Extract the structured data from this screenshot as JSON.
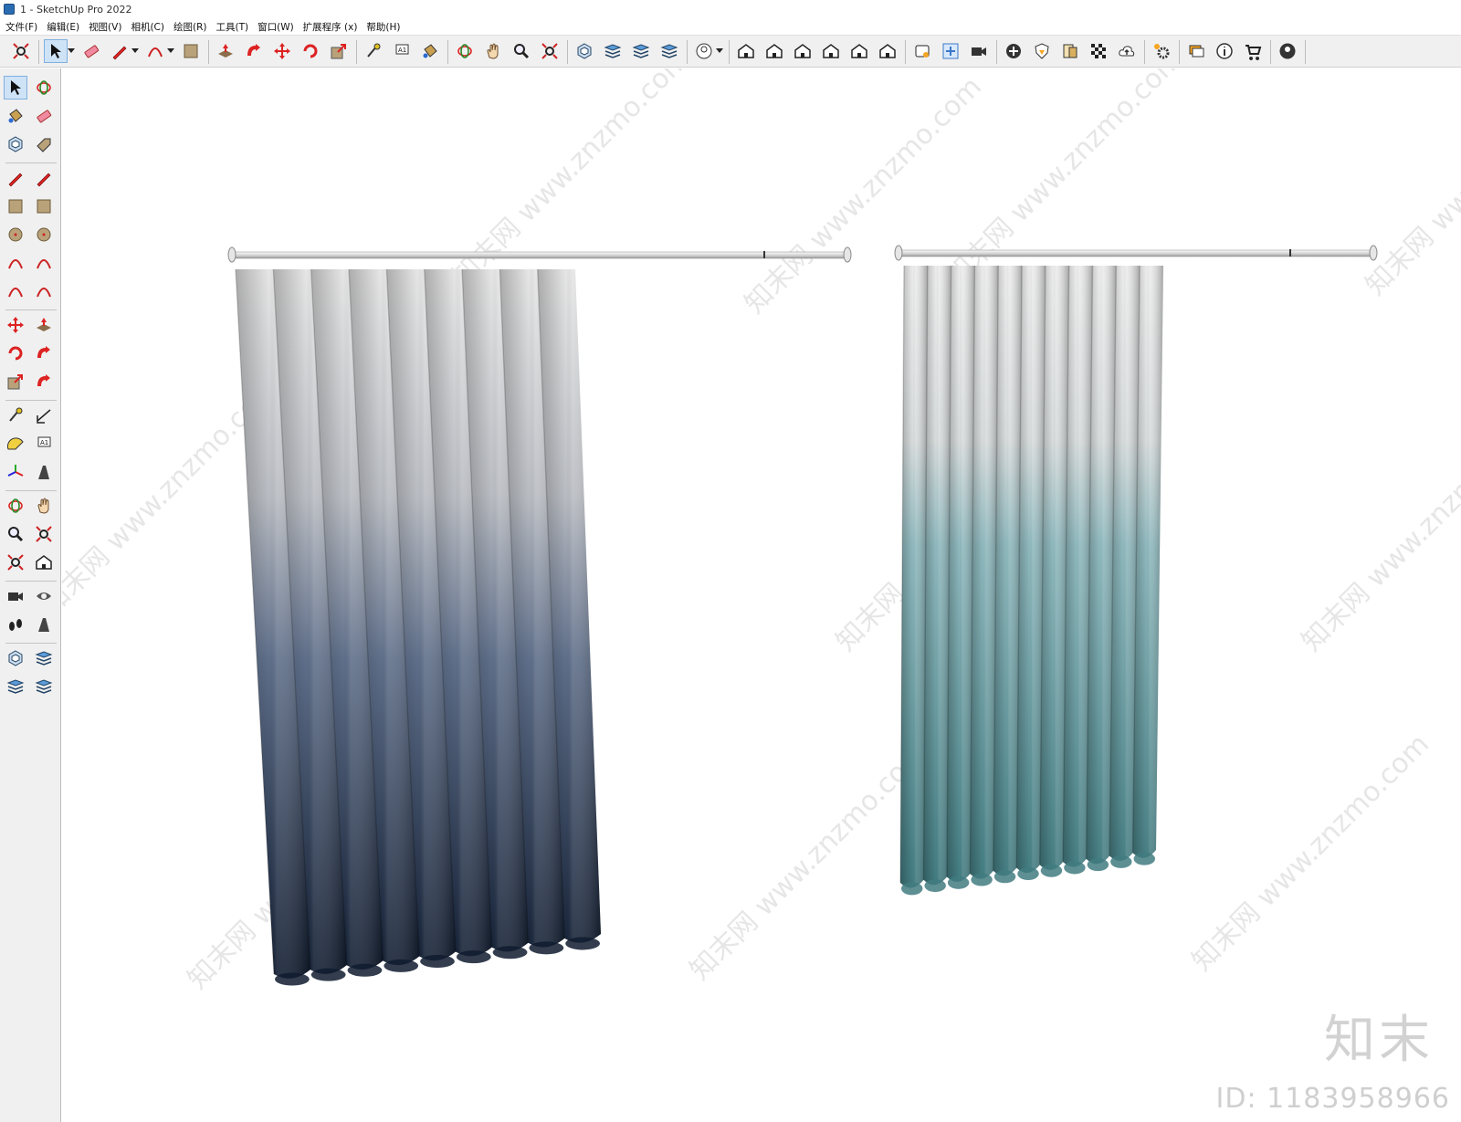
{
  "window": {
    "title": "1 - SketchUp Pro 2022"
  },
  "menu": {
    "items": [
      "文件(F)",
      "编辑(E)",
      "视图(V)",
      "相机(C)",
      "绘图(R)",
      "工具(T)",
      "窗口(W)",
      "扩展程序 (x)",
      "帮助(H)"
    ]
  },
  "toolbar": {
    "groups": [
      [
        "zoom-extents-icon"
      ],
      [
        "select-icon",
        "eraser-icon",
        "pencil-line-icon",
        "arc-icon",
        "rectangle-icon"
      ],
      [
        "push-pull-icon",
        "follow-me-icon",
        "move-icon",
        "rotate-icon",
        "scale-icon"
      ],
      [
        "tape-measure-icon",
        "text-label-icon",
        "paint-bucket-icon"
      ],
      [
        "orbit-icon",
        "pan-icon",
        "zoom-icon",
        "zoom-extents-icon"
      ],
      [
        "sandbox-icon",
        "layers-icon",
        "layer-stack-icon",
        "tags-icon"
      ],
      [
        "user-profile-icon"
      ],
      [
        "iso-view-icon",
        "top-view-icon",
        "front-view-icon",
        "right-view-icon",
        "back-view-icon",
        "left-view-icon"
      ],
      [
        "warehouse-icon",
        "extension-manager-icon",
        "camera-record-icon"
      ],
      [
        "add-location-icon",
        "shield-icon",
        "materials-icon",
        "checker-icon",
        "cloud-upload-icon"
      ],
      [
        "settings-icon"
      ],
      [
        "chat-icon",
        "info-icon",
        "cart-icon"
      ],
      [
        "account-icon"
      ]
    ]
  },
  "left_toolbar": {
    "items": [
      "select-icon",
      "orbit-icon",
      "paint-bucket-icon",
      "eraser-icon",
      "component-icon",
      "tag-icon",
      "pencil-line-icon",
      "freehand-icon",
      "rectangle-icon",
      "rotated-rectangle-icon",
      "circle-icon",
      "polygon-icon",
      "arc-icon",
      "two-point-arc-icon",
      "three-point-arc-icon",
      "pie-icon",
      "move-icon",
      "push-pull-icon",
      "rotate-icon",
      "follow-me-icon",
      "scale-icon",
      "offset-icon",
      "tape-measure-icon",
      "dimension-icon",
      "protractor-icon",
      "text-icon",
      "axes-icon",
      "section-plane-icon",
      "orbit-icon",
      "pan-icon",
      "zoom-icon",
      "zoom-window-icon",
      "zoom-extents-icon",
      "previous-view-icon",
      "position-camera-icon",
      "look-around-icon",
      "walk-icon",
      "section-cut-icon",
      "sandbox-icon",
      "layers-icon",
      "layer-stack-icon",
      "tags-icon"
    ]
  },
  "scene": {
    "watermark": "知末网 www.znzmo.com",
    "brand": "知末",
    "id_label": "ID: 1183958966",
    "curtains": [
      {
        "name": "blue-gradient-curtain",
        "top_color": "#e6e6e6",
        "bottom_color": "#0f1b2f",
        "folds": 9
      },
      {
        "name": "teal-gradient-curtain",
        "top_color": "#ececec",
        "bottom_color": "#417b80",
        "folds": 11
      }
    ]
  }
}
